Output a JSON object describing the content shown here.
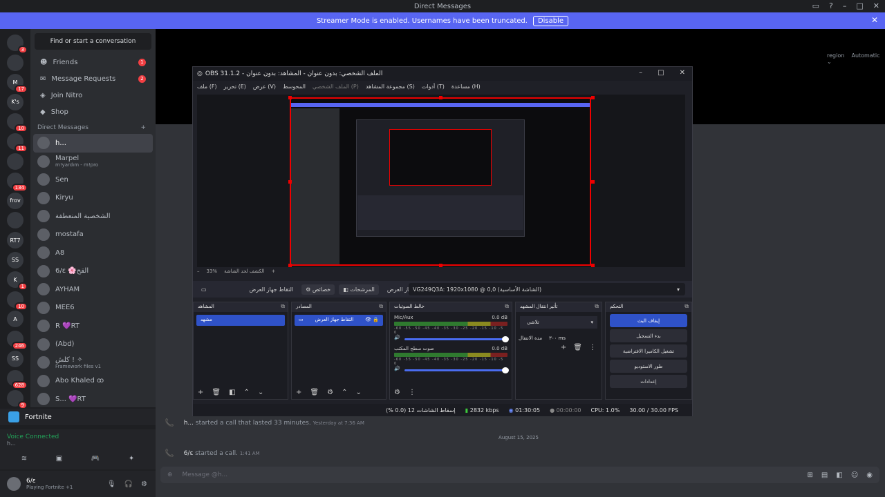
{
  "discord": {
    "window_title": "Direct Messages",
    "streamer_banner": "Streamer Mode is enabled. Usernames have been truncated.",
    "streamer_disable": "Disable",
    "search_placeholder": "Find or start a conversation",
    "nav": [
      {
        "label": "Friends",
        "count": "1"
      },
      {
        "label": "Message Requests",
        "count": "2"
      },
      {
        "label": "Join Nitro",
        "count": ""
      },
      {
        "label": "Shop",
        "count": ""
      }
    ],
    "dm_header": "Direct Messages",
    "dms": [
      {
        "name": "h...",
        "sub": ""
      },
      {
        "name": "Marpel",
        "sub": "m!yardım - m!pro"
      },
      {
        "name": "Sen",
        "sub": ""
      },
      {
        "name": "Kiryu",
        "sub": ""
      },
      {
        "name": "الشخصية المنعطفة",
        "sub": ""
      },
      {
        "name": "mostafa",
        "sub": ""
      },
      {
        "name": "A8",
        "sub": ""
      },
      {
        "name": "6/ε 🌸القح",
        "sub": ""
      },
      {
        "name": "AYHAM",
        "sub": ""
      },
      {
        "name": "MEE6",
        "sub": ""
      },
      {
        "name": "R 💜RT",
        "sub": ""
      },
      {
        "name": "(Abd)",
        "sub": ""
      },
      {
        "name": "كلش ! ✧",
        "sub": "Framework files v1"
      },
      {
        "name": "Abo Khaled ꝏ",
        "sub": ""
      },
      {
        "name": "S... 💜RT",
        "sub": ""
      }
    ],
    "servers": [
      {
        "label": "",
        "badge": "3"
      },
      {
        "label": "",
        "badge": ""
      },
      {
        "label": "M",
        "badge": "17"
      },
      {
        "label": "K's",
        "badge": ""
      },
      {
        "label": "",
        "badge": "10"
      },
      {
        "label": "",
        "badge": "11"
      },
      {
        "label": "",
        "badge": ""
      },
      {
        "label": "",
        "badge": "134"
      },
      {
        "label": "frov",
        "badge": ""
      },
      {
        "label": "",
        "badge": ""
      },
      {
        "label": "RT7",
        "badge": ""
      },
      {
        "label": "SS",
        "badge": ""
      },
      {
        "label": "K",
        "badge": "1"
      },
      {
        "label": "",
        "badge": "10"
      },
      {
        "label": "A",
        "badge": ""
      },
      {
        "label": "",
        "badge": "246"
      },
      {
        "label": "SS",
        "badge": ""
      },
      {
        "label": "",
        "badge": "628"
      },
      {
        "label": "",
        "badge": "9"
      }
    ],
    "game_activity": "Fortnite",
    "voice_status": "Voice Connected",
    "voice_channel": "h...",
    "user_name": "6/ε",
    "user_status": "Playing Fortnite +1",
    "region_label": "region",
    "region_value": "Automatic ⌄",
    "messages": [
      {
        "user": "h...",
        "text": "started a call that lasted 33 minutes.",
        "time": "Yesterday at 7:36 AM"
      },
      {
        "user": "6/ε",
        "text": "started a call.",
        "time": "1:41 AM"
      }
    ],
    "date_divider": "August 15, 2025",
    "composer_placeholder": "Message @h..."
  },
  "obs": {
    "title": "OBS 31.1.2 - الملف الشخصي: بدون عنوان - المشاهد: بدون عنوان",
    "menu": [
      "ملف (F)",
      "تحرير (E)",
      "عرض (V)",
      "المحوسط",
      "الملف الشخصي (P)",
      "مجموعة المشاهد (S)",
      "أدوات (T)",
      "مساعدة (H)"
    ],
    "zoom": "33%",
    "zoom_caption": "الكشف لحد الشاشة",
    "source_bar": {
      "name": "التقاط جهاز العرض",
      "props": "خصائص",
      "filters": "المرشحات",
      "device_label": "جهاز العرض",
      "device_value": "VG249Q3A: 1920x1080 @ 0,0 (الشاشة الأساسية)"
    },
    "docks": {
      "scenes_title": "المشاهد",
      "scene_item": "مشهد",
      "sources_title": "المصادر",
      "source_item": "التقاط جهاز العرض",
      "mixer_title": "خالط الصوتيات",
      "mixer_tracks": [
        {
          "name": "Mic/Aux",
          "db": "0.0 dB",
          "level": 1.0
        },
        {
          "name": "صوت سطح المكتب",
          "db": "0.0 dB",
          "level": 1.0
        }
      ],
      "meter_ticks": "-60 -55 -50 -45 -40 -35 -30 -25 -20 -15 -10 -5 0",
      "transition_title": "تأثير انتقال المشهد",
      "transition_value": "تلاشي",
      "duration_label": "مدة الانتقال",
      "duration_value": "٣٠٠ ms",
      "controls_title": "التحكم",
      "controls": [
        "إيقاف البث",
        "بدء التسجيل",
        "تشغيل الكاميرا الافتراضية",
        "طور الاستوديو",
        "إعدادات"
      ]
    },
    "status": {
      "dropped": "إسقاط الشاشات 12 (0.0 %)",
      "bitrate": "2832 kbps",
      "stream_time": "01:30:05",
      "rec_time": "00:00:00",
      "cpu": "CPU: 1.0%",
      "fps": "30.00 / 30.00 FPS"
    }
  },
  "colors": {
    "accent": "#5865f2",
    "obs_accent": "#2f52c8",
    "alert": "#f23f43",
    "online": "#23a55a"
  }
}
